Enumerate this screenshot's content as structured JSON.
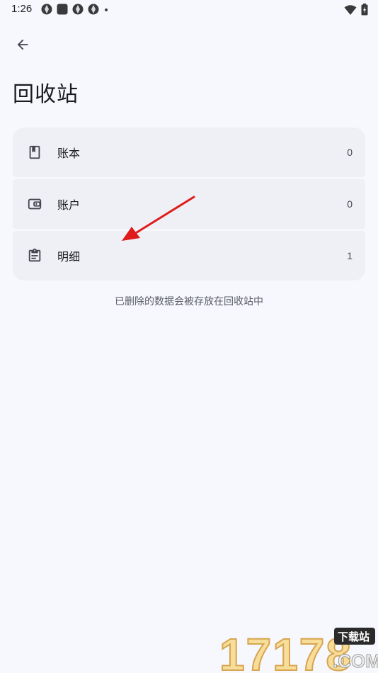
{
  "status_bar": {
    "time": "1:26"
  },
  "header": {
    "title": "回收站"
  },
  "list": {
    "items": [
      {
        "label": "账本",
        "count": "0",
        "icon": "book-icon"
      },
      {
        "label": "账户",
        "count": "0",
        "icon": "wallet-icon"
      },
      {
        "label": "明细",
        "count": "1",
        "icon": "clipboard-icon"
      }
    ]
  },
  "hint": "已删除的数据会被存放在回收站中",
  "watermark": {
    "number": "17178",
    "tag": "下载站",
    "domain": ".COM"
  },
  "colors": {
    "background": "#f7f8fd",
    "card": "#eff0f5",
    "arrow": "#e01b1b"
  }
}
